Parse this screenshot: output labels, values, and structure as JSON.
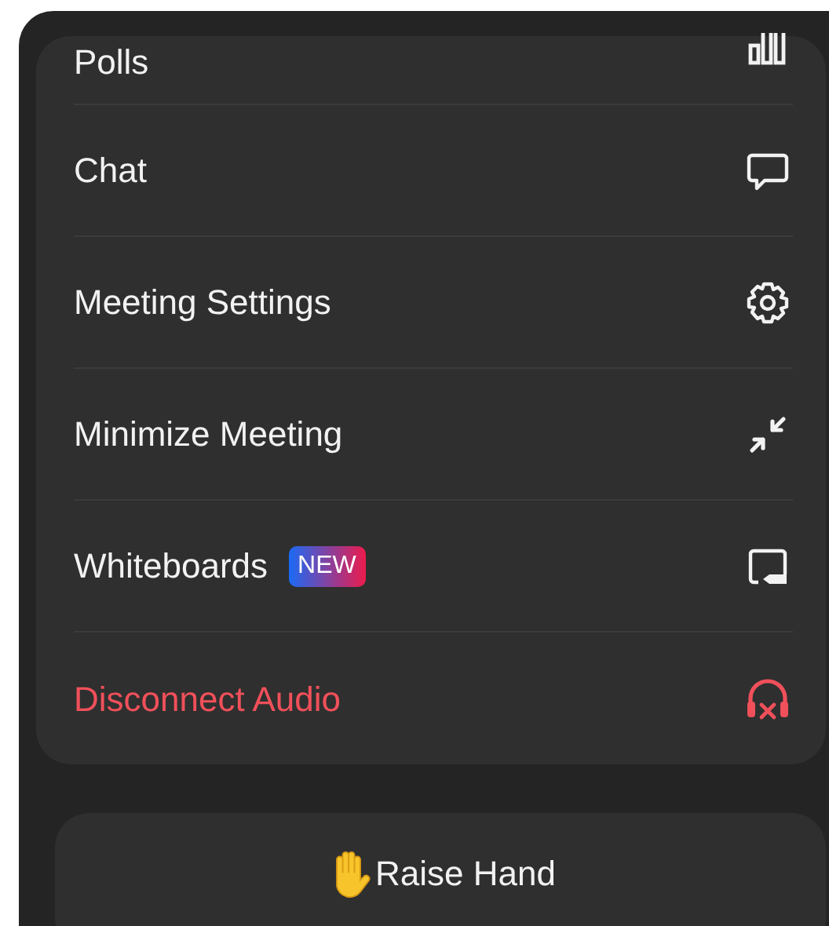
{
  "menu_items": [
    {
      "kind": "polls",
      "label": "Polls"
    },
    {
      "kind": "chat",
      "label": "Chat"
    },
    {
      "kind": "settings",
      "label": "Meeting Settings"
    },
    {
      "kind": "minimize",
      "label": "Minimize Meeting"
    },
    {
      "kind": "whiteboard",
      "label": "Whiteboards",
      "badge": "NEW"
    },
    {
      "kind": "disconnect",
      "label": "Disconnect Audio"
    }
  ],
  "raise_hand_button": {
    "label": "Raise Hand"
  }
}
